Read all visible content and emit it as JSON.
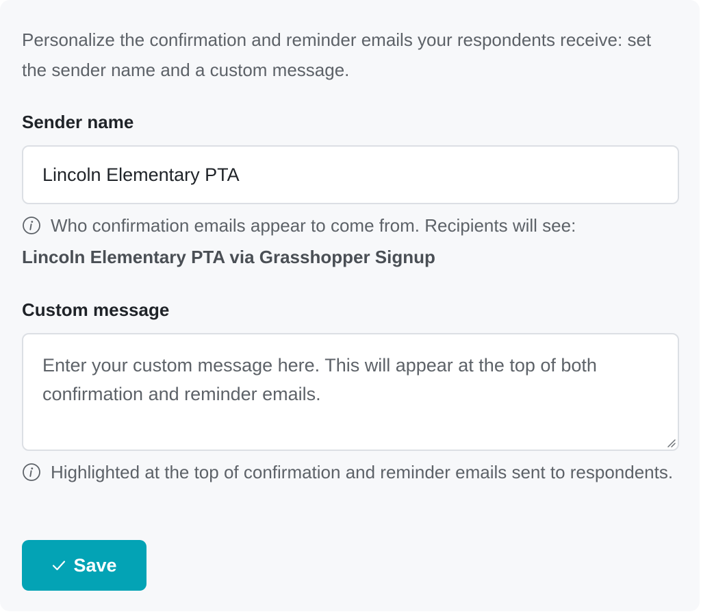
{
  "intro_text": "Personalize the confirmation and reminder emails your respondents receive: set the sender name and a custom message.",
  "sender": {
    "label": "Sender name",
    "value": "Lincoln Elementary PTA",
    "help_text": "Who confirmation emails appear to come from. Recipients will see:",
    "help_preview": "Lincoln Elementary PTA via Grasshopper Signup"
  },
  "custom_message": {
    "label": "Custom message",
    "value": "",
    "placeholder": "Enter your custom message here. This will appear at the top of both confirmation and reminder emails.",
    "help_text": "Highlighted at the top of confirmation and reminder emails sent to respondents."
  },
  "save_button": {
    "label": "Save",
    "icon": "check-icon"
  },
  "colors": {
    "accent": "#03a3b5",
    "panel_background": "#f7f8fa",
    "muted_text": "#5d6268"
  }
}
